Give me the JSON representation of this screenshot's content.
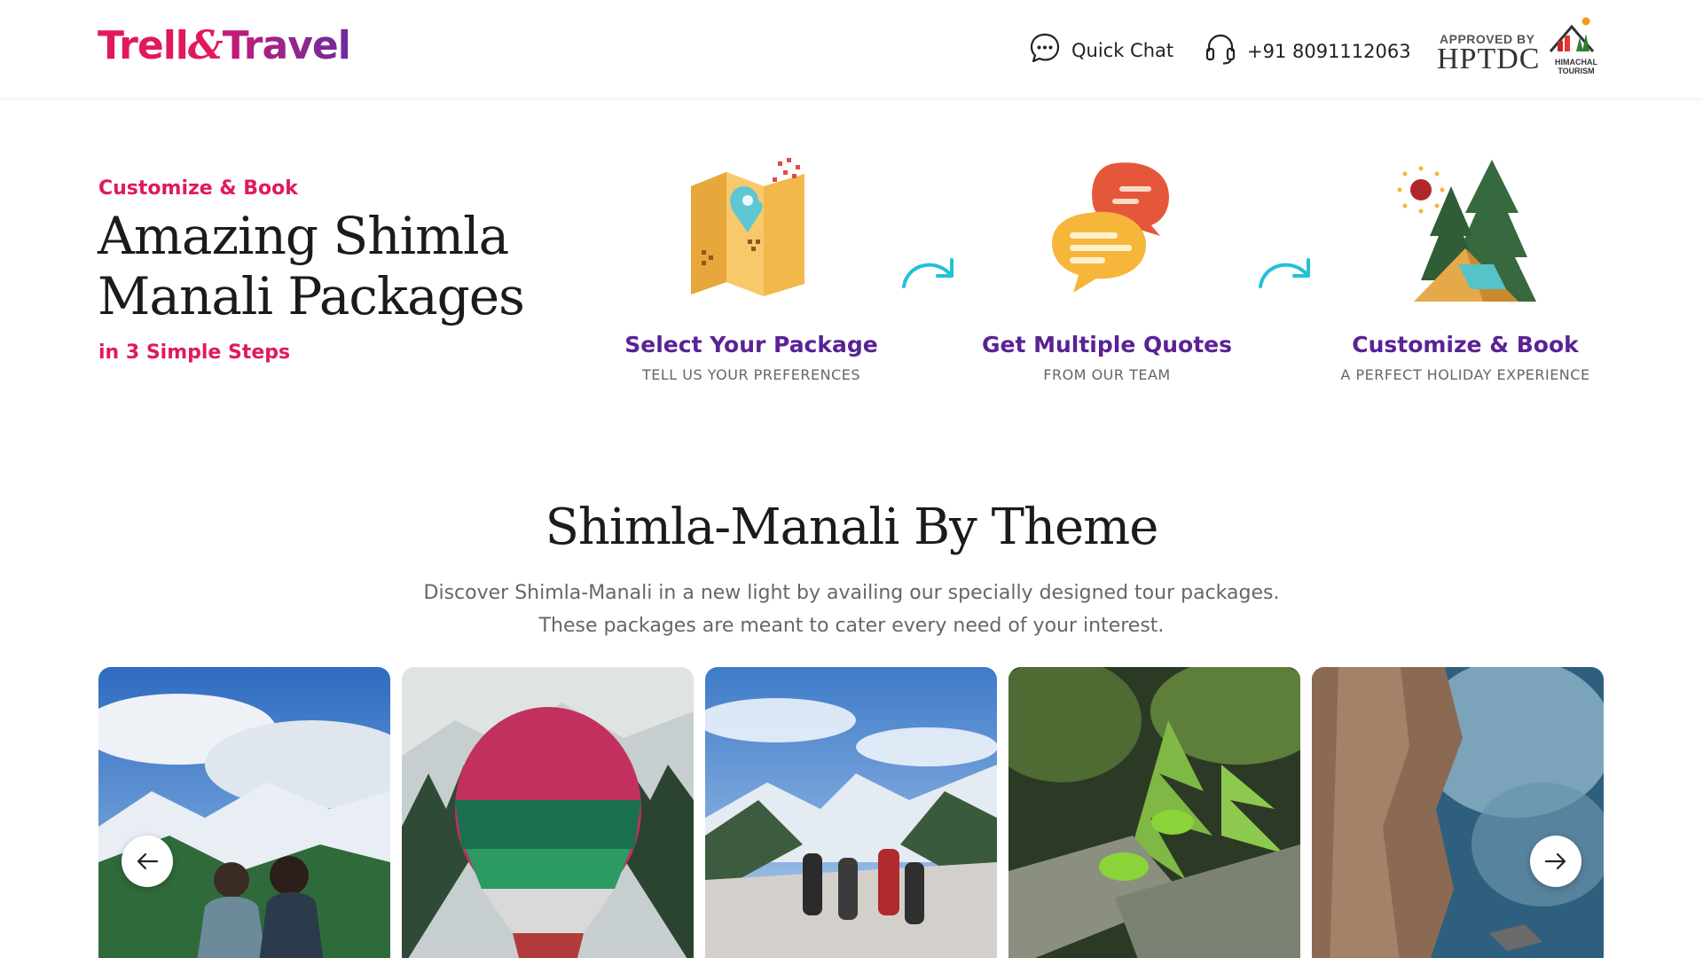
{
  "header": {
    "logo": {
      "part1": "Trell",
      "amp": "&",
      "part2": "Travel"
    },
    "quick_chat_label": "Quick Chat",
    "phone_label": "+91 8091112063",
    "approved_by": "APPROVED BY",
    "approver": "HPTDC",
    "approver_tag": "HIMACHAL TOURISM"
  },
  "intro": {
    "kicker": "Customize & Book",
    "headline": "Amazing Shimla Manali Packages",
    "subkicker": "in 3 Simple Steps"
  },
  "steps": [
    {
      "title": "Select Your Package",
      "subtitle": "TELL US YOUR PREFERENCES",
      "icon": "map-pin-icon"
    },
    {
      "title": "Get Multiple Quotes",
      "subtitle": "FROM OUR TEAM",
      "icon": "chat-bubbles-icon"
    },
    {
      "title": "Customize & Book",
      "subtitle": "A PERFECT HOLIDAY EXPERIENCE",
      "icon": "tent-trees-icon"
    }
  ],
  "theme_section": {
    "title": "Shimla-Manali By Theme",
    "description_line1": "Discover Shimla-Manali in a new light by availing our specially designed tour packages.",
    "description_line2": "These packages are meant to cater every need of your interest."
  },
  "cards": [
    {
      "name": "mountain-couple-photo"
    },
    {
      "name": "hot-air-balloon-photo"
    },
    {
      "name": "snow-trek-photo"
    },
    {
      "name": "forest-rest-photo"
    },
    {
      "name": "rock-cliff-photo"
    }
  ],
  "colors": {
    "accent_pink": "#e0195f",
    "accent_purple": "#5a2295",
    "arrow_cyan": "#22c1d6"
  }
}
